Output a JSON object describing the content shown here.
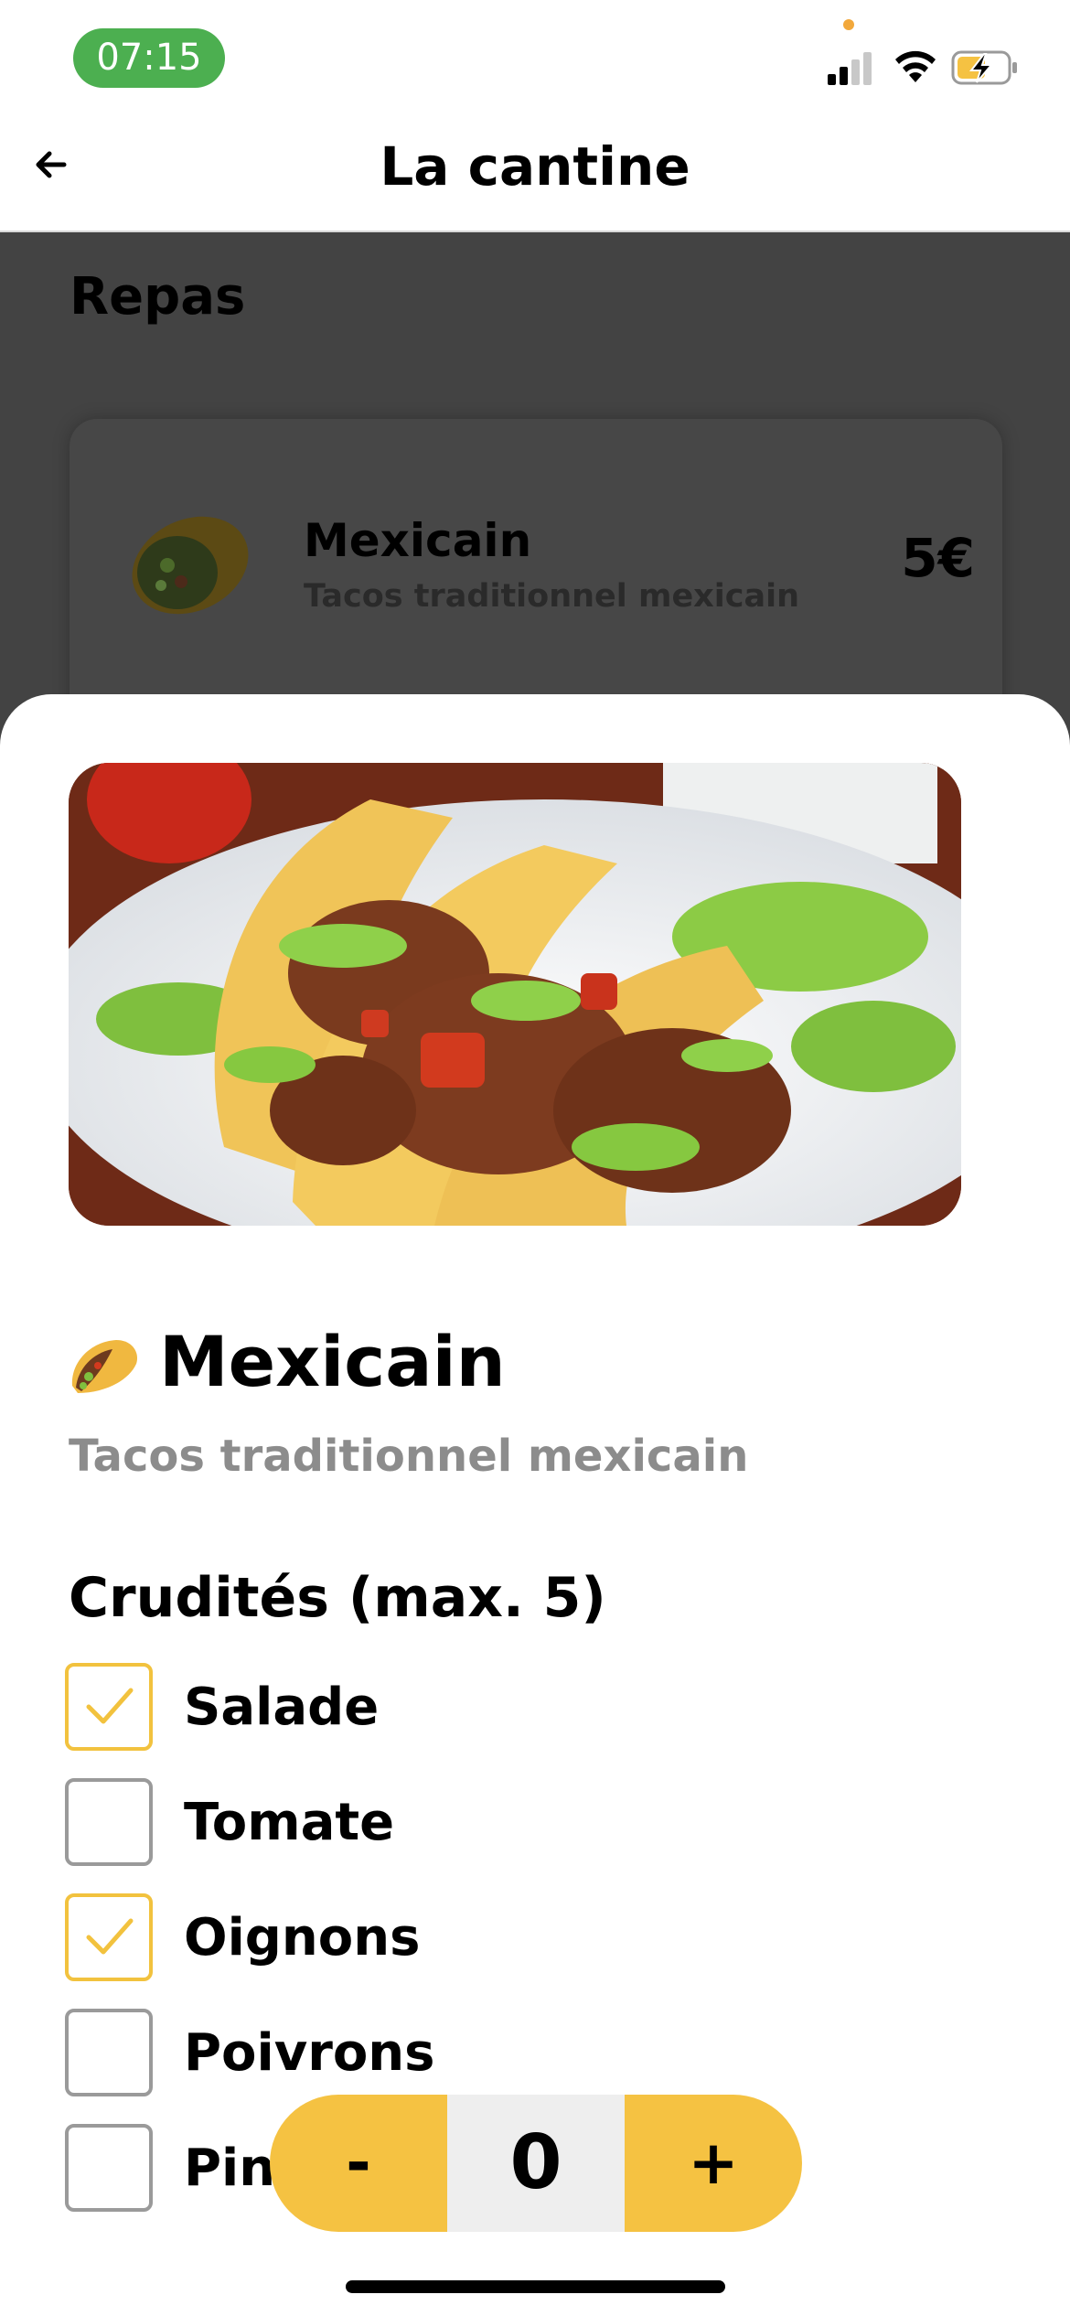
{
  "status_bar": {
    "time": "07:15"
  },
  "nav": {
    "title": "La cantine"
  },
  "background_page": {
    "section_title": "Repas",
    "meal": {
      "name": "Mexicain",
      "description": "Tacos traditionnel mexicain",
      "price": "5€"
    }
  },
  "sheet": {
    "product_title": "Mexicain",
    "product_description": "Tacos traditionnel mexicain",
    "option_group_title": "Crudités (max. 5)",
    "options": [
      {
        "label": "Salade",
        "checked": true
      },
      {
        "label": "Tomate",
        "checked": false
      },
      {
        "label": "Oignons",
        "checked": true
      },
      {
        "label": "Poivrons",
        "checked": false
      },
      {
        "label": "Pin",
        "checked": false
      }
    ]
  },
  "stepper": {
    "minus_label": "-",
    "value": "0",
    "plus_label": "+"
  },
  "colors": {
    "accent": "#f5c242",
    "status_green": "#4caf50",
    "overlay": "#434343"
  },
  "icons": [
    "back-arrow-icon",
    "signal-icon",
    "wifi-icon",
    "battery-charging-icon",
    "taco-icon",
    "checkmark-icon"
  ]
}
